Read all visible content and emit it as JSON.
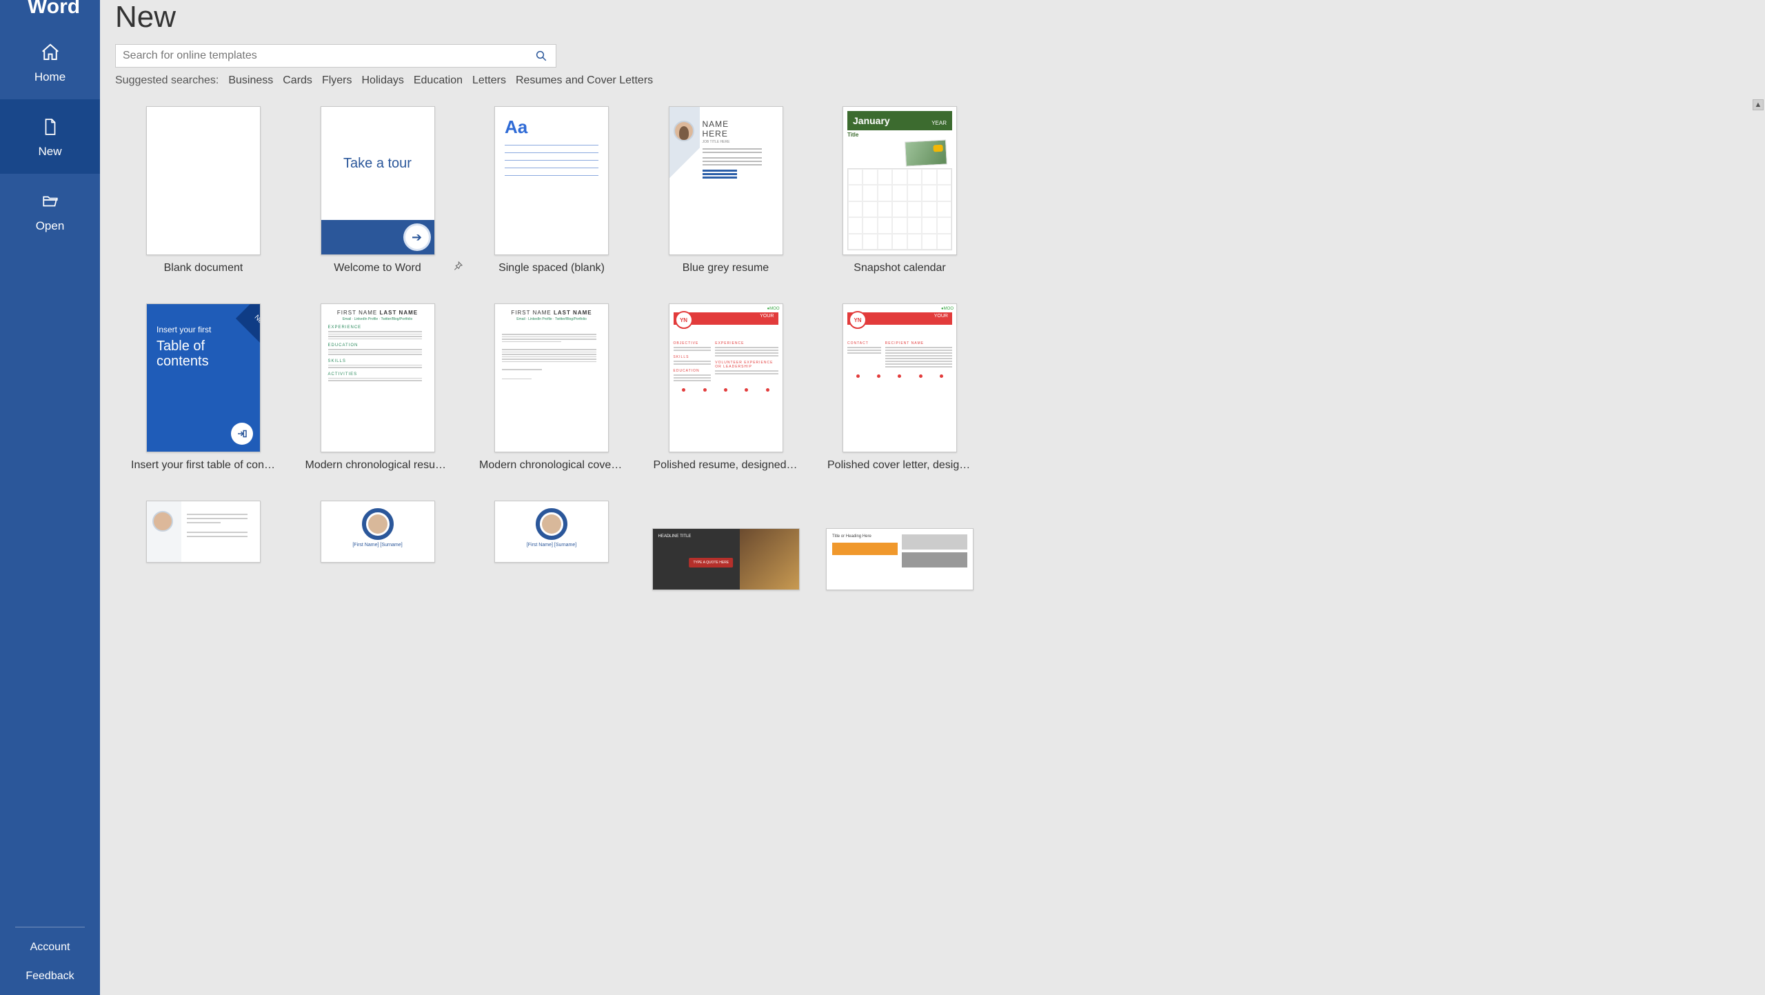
{
  "app": {
    "brand": "Word"
  },
  "sidebar": {
    "items": [
      {
        "id": "home",
        "label": "Home"
      },
      {
        "id": "new",
        "label": "New"
      },
      {
        "id": "open",
        "label": "Open"
      }
    ],
    "active": "new",
    "bottom": [
      {
        "id": "account",
        "label": "Account"
      },
      {
        "id": "feedback",
        "label": "Feedback"
      }
    ]
  },
  "page": {
    "title": "New"
  },
  "search": {
    "placeholder": "Search for online templates"
  },
  "suggested": {
    "label": "Suggested searches:",
    "items": [
      "Business",
      "Cards",
      "Flyers",
      "Holidays",
      "Education",
      "Letters",
      "Resumes and Cover Letters"
    ]
  },
  "templates": [
    {
      "id": "blank",
      "label": "Blank document",
      "kind": "blank"
    },
    {
      "id": "welcome",
      "label": "Welcome to Word",
      "kind": "tour",
      "pinned": true,
      "tour_text": "Take a tour"
    },
    {
      "id": "single",
      "label": "Single spaced (blank)",
      "kind": "single",
      "aa": "Aa"
    },
    {
      "id": "bluegrey",
      "label": "Blue grey resume",
      "kind": "resume1",
      "name_top": "NAME",
      "name_bottom": "HERE",
      "subtitle": "JOB TITLE HERE"
    },
    {
      "id": "snapshot",
      "label": "Snapshot calendar",
      "kind": "calendar",
      "month": "January",
      "year": "YEAR",
      "title": "Title"
    },
    {
      "id": "toc",
      "label": "Insert your first table of contents",
      "kind": "toc",
      "corner": "New",
      "line1": "Insert your first",
      "line2": "Table of",
      "line3": "contents"
    },
    {
      "id": "chronres",
      "label": "Modern chronological resume",
      "kind": "chronres",
      "first": "FIRST NAME",
      "last": "LAST NAME",
      "sections": [
        "EXPERIENCE",
        "EDUCATION",
        "SKILLS",
        "ACTIVITIES"
      ]
    },
    {
      "id": "chroncov",
      "label": "Modern chronological cover letter",
      "kind": "chroncov",
      "first": "FIRST NAME",
      "last": "LAST NAME"
    },
    {
      "id": "polres",
      "label": "Polished resume, designed by MOO",
      "kind": "polished",
      "badge": "YN",
      "your": "YOUR",
      "moo": "MOO",
      "leftHeads": [
        "OBJECTIVE",
        "SKILLS",
        "EDUCATION"
      ],
      "rightHeads": [
        "EXPERIENCE",
        "VOLUNTEER EXPERIENCE OR LEADERSHIP"
      ]
    },
    {
      "id": "polcov",
      "label": "Polished cover letter, designed by MOO",
      "kind": "polishedcov",
      "badge": "YN",
      "your": "YOUR",
      "moo": "MOO",
      "leftHeads": [
        "CONTACT"
      ],
      "rightHeads": [
        "RECIPIENT NAME"
      ]
    },
    {
      "id": "row3a",
      "label": "",
      "kind": "resume3"
    },
    {
      "id": "row3b",
      "label": "",
      "kind": "circpic",
      "name": "[First Name]\n[Surname]"
    },
    {
      "id": "row3c",
      "label": "",
      "kind": "circpic",
      "name": "[First Name]\n[Surname]"
    },
    {
      "id": "row3d",
      "label": "",
      "kind": "creative",
      "headline": "HEADLINE TITLE"
    },
    {
      "id": "row3e",
      "label": "",
      "kind": "orange",
      "heading": "Title or Heading Here"
    }
  ]
}
